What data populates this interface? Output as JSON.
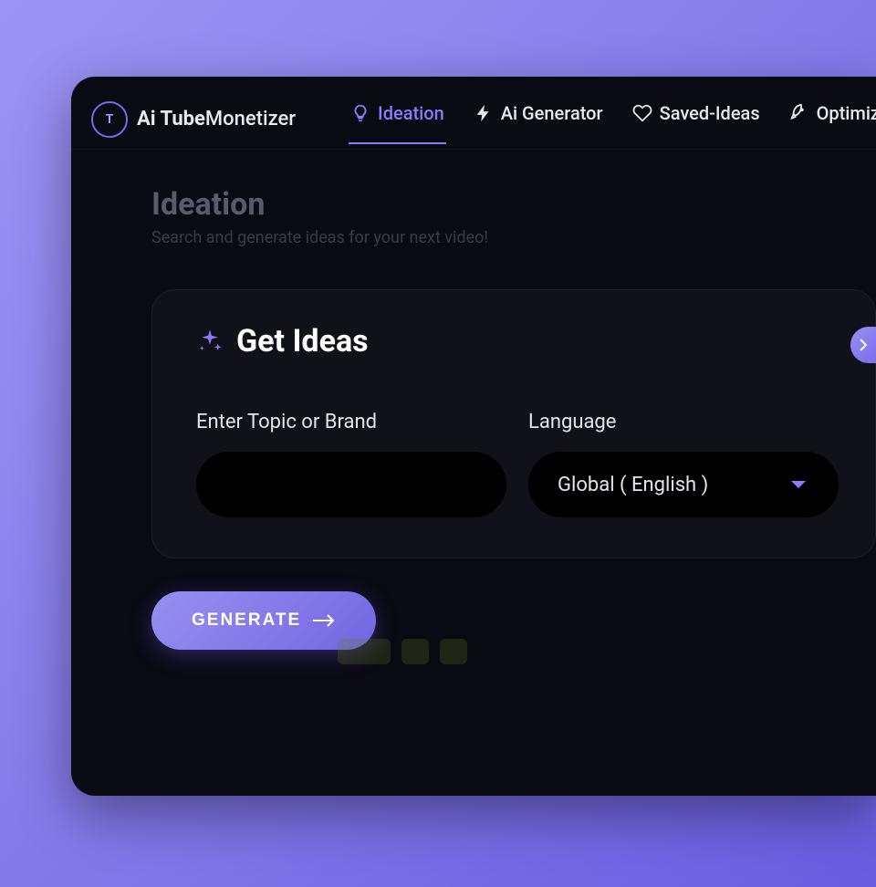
{
  "brand": {
    "bold": "Ai Tube",
    "light": "Monetizer"
  },
  "nav": {
    "ideation": "Ideation",
    "generator": "Ai Generator",
    "saved": "Saved-Ideas",
    "optimize": "Optimiz"
  },
  "page": {
    "title": "Ideation",
    "subtitle": "Search and generate ideas for your next video!"
  },
  "card": {
    "title": "Get Ideas",
    "topic_label": "Enter Topic or Brand",
    "topic_value": "",
    "lang_label": "Language",
    "lang_value": "Global ( English )"
  },
  "actions": {
    "generate": "GENERATE"
  },
  "colors": {
    "accent": "#8b7bff",
    "bg": "#0a0a12"
  }
}
